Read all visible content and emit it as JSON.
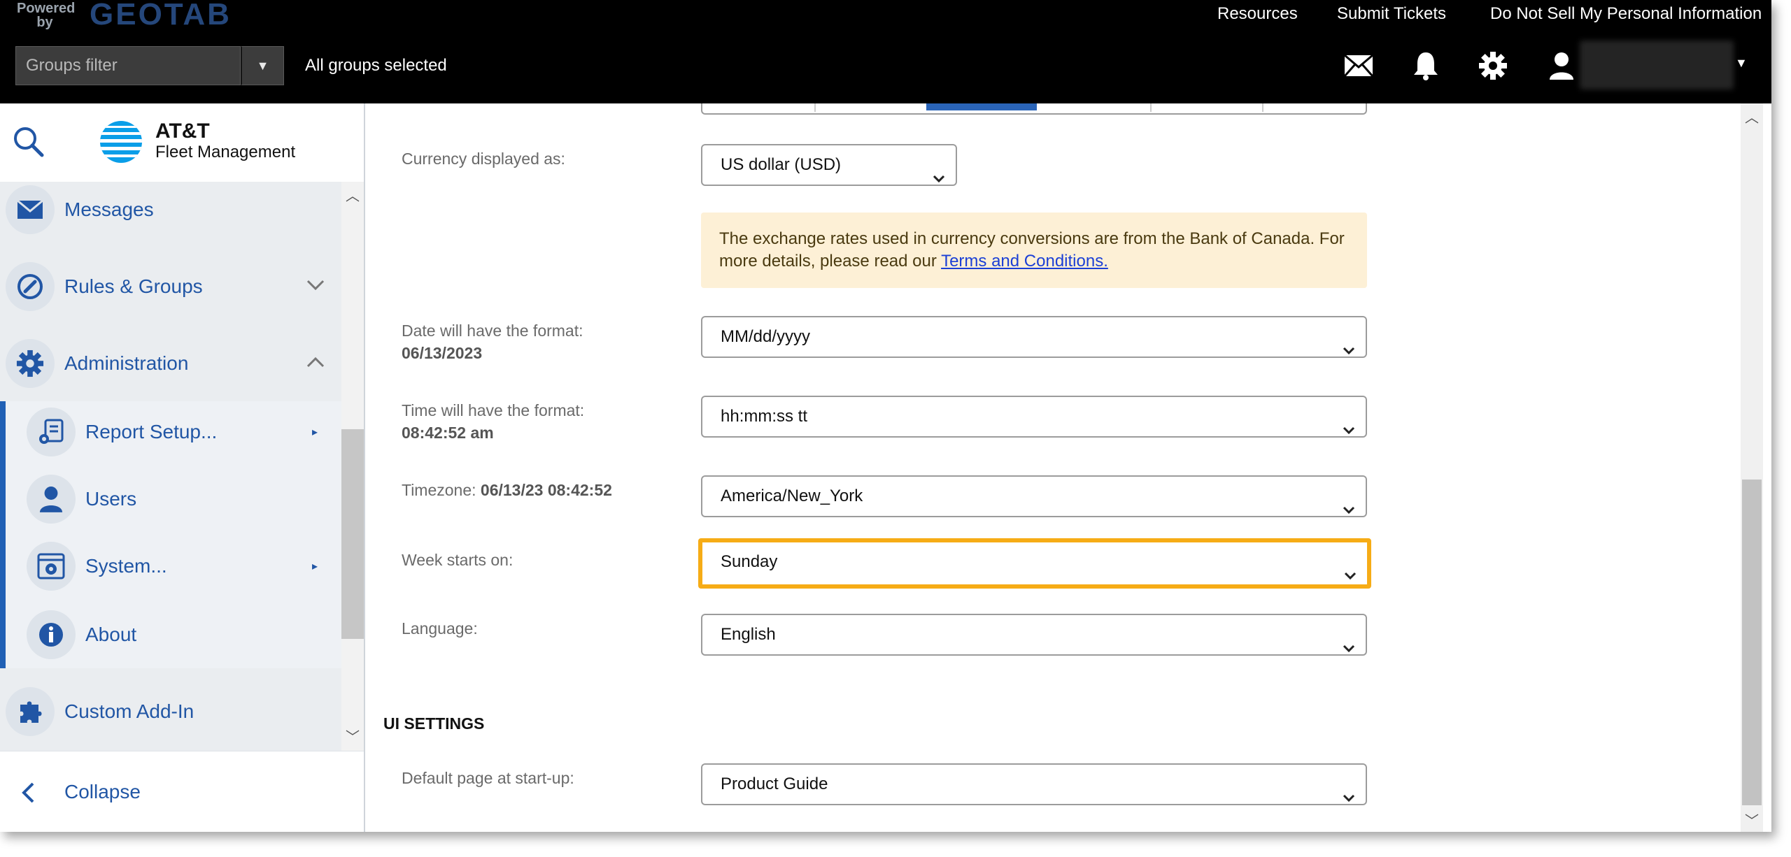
{
  "topbar": {
    "powered_by": "Powered by",
    "brand": "GEOTAB",
    "links": [
      "Resources",
      "Submit Tickets",
      "Do Not Sell My Personal Information"
    ],
    "groups_filter_placeholder": "Groups filter",
    "groups_status": "All groups selected",
    "icons": [
      "mail-icon",
      "bell-icon",
      "gear-icon",
      "user-icon"
    ]
  },
  "sidebar": {
    "brand_title": "AT&T",
    "brand_subtitle": "Fleet Management",
    "items": [
      {
        "label": "Messages",
        "icon": "mail-icon"
      },
      {
        "label": "Rules & Groups",
        "icon": "rules-icon"
      },
      {
        "label": "Administration",
        "icon": "gear-icon"
      }
    ],
    "sub_items": [
      {
        "label": "Report Setup...",
        "icon": "report-setup-icon"
      },
      {
        "label": "Users",
        "icon": "user-icon"
      },
      {
        "label": "System...",
        "icon": "system-icon"
      },
      {
        "label": "About",
        "icon": "info-icon"
      }
    ],
    "addin": {
      "label": "Custom Add-In",
      "icon": "puzzle-icon"
    },
    "collapse_label": "Collapse"
  },
  "form": {
    "currency": {
      "label": "Currency displayed as:",
      "value": "US dollar (USD)"
    },
    "notice": {
      "text": "The exchange rates used in currency conversions are from the Bank of Canada. For more details, please read our ",
      "link": "Terms and Conditions."
    },
    "date": {
      "label": "Date will have the format:",
      "example": "06/13/2023",
      "value": "MM/dd/yyyy"
    },
    "time": {
      "label": "Time will have the format:",
      "example": "08:42:52 am",
      "value": "hh:mm:ss tt"
    },
    "timezone": {
      "label": "Timezone:",
      "example": "06/13/23 08:42:52",
      "value": "America/New_York"
    },
    "week_start": {
      "label": "Week starts on:",
      "value": "Sunday"
    },
    "language": {
      "label": "Language:",
      "value": "English"
    },
    "ui_settings_heading": "UI SETTINGS",
    "default_page": {
      "label": "Default page at start-up:",
      "value": "Product Guide"
    }
  },
  "colors": {
    "accent": "#2156a5",
    "highlight": "#f6ac16",
    "notice_bg": "#fdf0d6",
    "topbar_bg": "#000000"
  }
}
